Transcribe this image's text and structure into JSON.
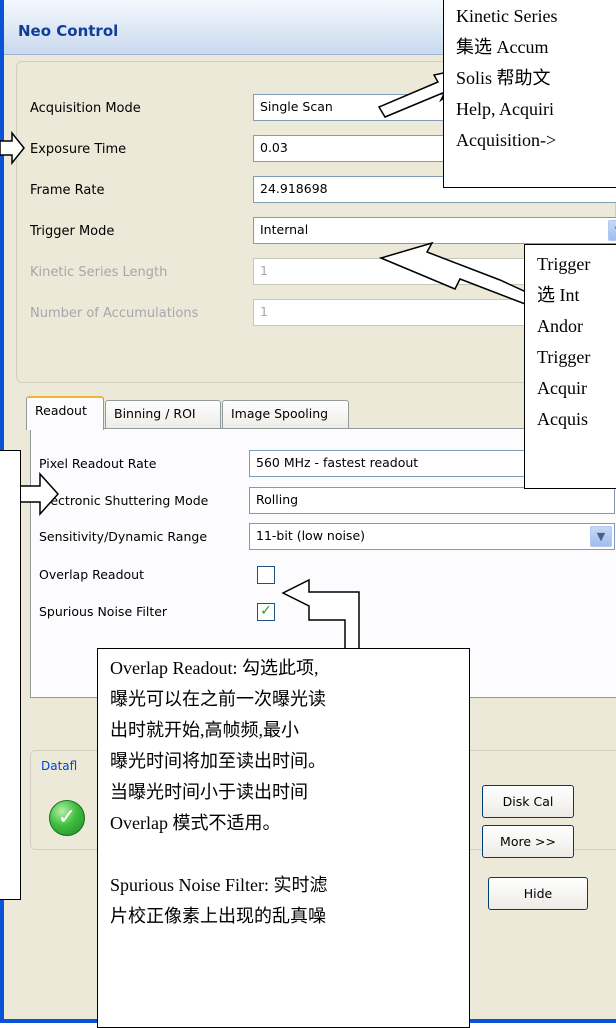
{
  "window": {
    "title": "Neo Control"
  },
  "settings": [
    {
      "label": "Acquisition Mode",
      "value": "Single Scan",
      "combo": false,
      "disabled": false
    },
    {
      "label": "Exposure Time",
      "value": "0.03",
      "combo": false,
      "disabled": false
    },
    {
      "label": "Frame Rate",
      "value": "24.918698",
      "combo": false,
      "disabled": false
    },
    {
      "label": "Trigger Mode",
      "value": "Internal",
      "combo": true,
      "disabled": false
    },
    {
      "label": "Kinetic Series Length",
      "value": "1",
      "combo": false,
      "disabled": true
    },
    {
      "label": "Number of Accumulations",
      "value": "1",
      "combo": false,
      "disabled": true
    }
  ],
  "tabs": [
    "Readout",
    "Binning / ROI",
    "Image Spooling"
  ],
  "readout": {
    "pixel_rate_label": "Pixel Readout Rate",
    "pixel_rate_value": "560 MHz - fastest readout",
    "shutter_label": "Electronic Shuttering Mode",
    "shutter_value": "Rolling",
    "sensitivity_label": "Sensitivity/Dynamic Range",
    "sensitivity_value": "11-bit (low noise)",
    "overlap_label": "Overlap Readout",
    "overlap_checked": false,
    "noise_label": "Spurious Noise Filter",
    "noise_checked": true,
    "check_mark": "✓"
  },
  "dataflow": {
    "label": "Datafl"
  },
  "buttons": {
    "disk_cal": "Disk Cal",
    "more": "More >>",
    "hide": "Hide"
  },
  "notes": {
    "top": [
      "Kinetic Series",
      "集选 Accum",
      "Solis 帮助文",
      "Help, Acquiri",
      "Acquisition->"
    ],
    "trigger": [
      "Trigger",
      "选 Int",
      "Andor",
      "Trigger",
      "Acquir",
      "Acquis"
    ],
    "overlap": [
      "Overlap Readout: 勾选此项,",
      "曝光可以在之前一次曝光读",
      "出时就开始,高帧频,最小",
      "曝光时间将加至读出时间。",
      "当曝光时间小于读出时间",
      "Overlap 模式不适用。",
      "",
      "Spurious Noise Filter: 实时滤",
      "片校正像素上出现的乱真噪"
    ],
    "left": [
      "",
      "",
      "",
      "",
      "",
      "",
      "",
      "",
      "",
      "",
      "",
      "",
      "",
      "",
      "",
      "",
      "",
      "",
      "",
      "",
      ""
    ]
  },
  "icons": {
    "combo_arrow": "chevron-down-icon",
    "status": "check-circle-icon"
  }
}
